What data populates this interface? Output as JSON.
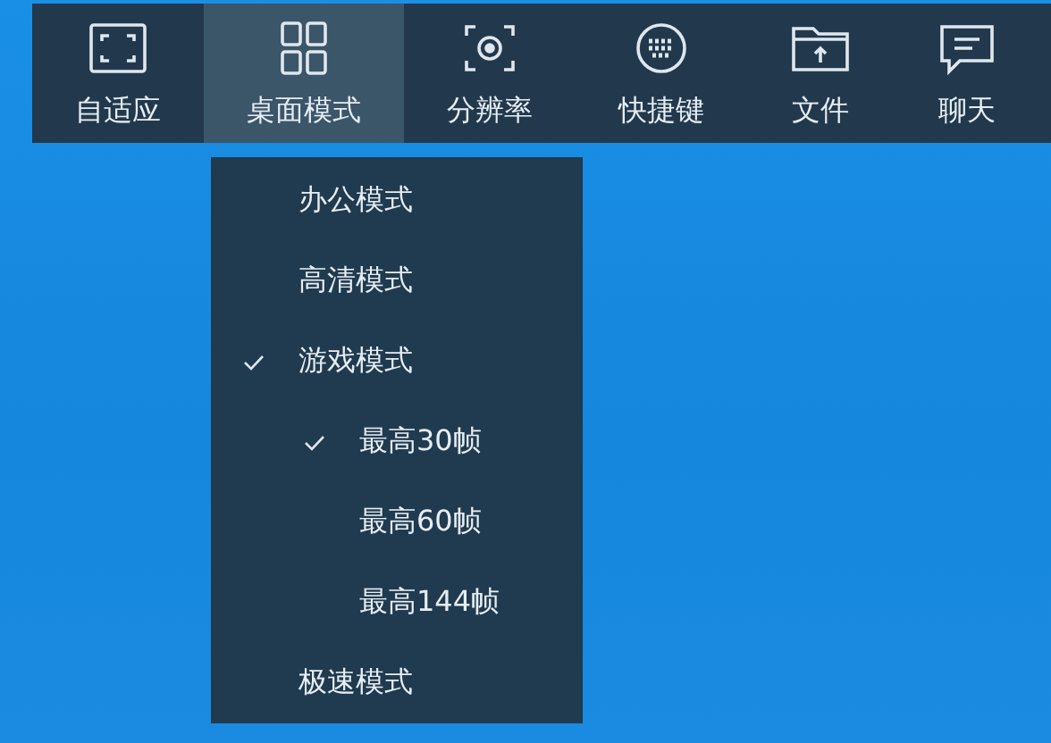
{
  "toolbar": [
    {
      "label": "自适应",
      "selected": false
    },
    {
      "label": "桌面模式",
      "selected": true
    },
    {
      "label": "分辨率",
      "selected": false
    },
    {
      "label": "快捷键",
      "selected": false
    },
    {
      "label": "文件",
      "selected": false
    },
    {
      "label": "聊天",
      "selected": false
    }
  ],
  "menu": [
    {
      "label": "办公模式",
      "checked": false
    },
    {
      "label": "高清模式",
      "checked": false
    },
    {
      "label": "游戏模式",
      "checked": true,
      "children": [
        {
          "label": "最高30帧",
          "checked": true
        },
        {
          "label": "最高60帧",
          "checked": false
        },
        {
          "label": "最高144帧",
          "checked": false
        }
      ]
    },
    {
      "label": "极速模式",
      "checked": false
    }
  ]
}
